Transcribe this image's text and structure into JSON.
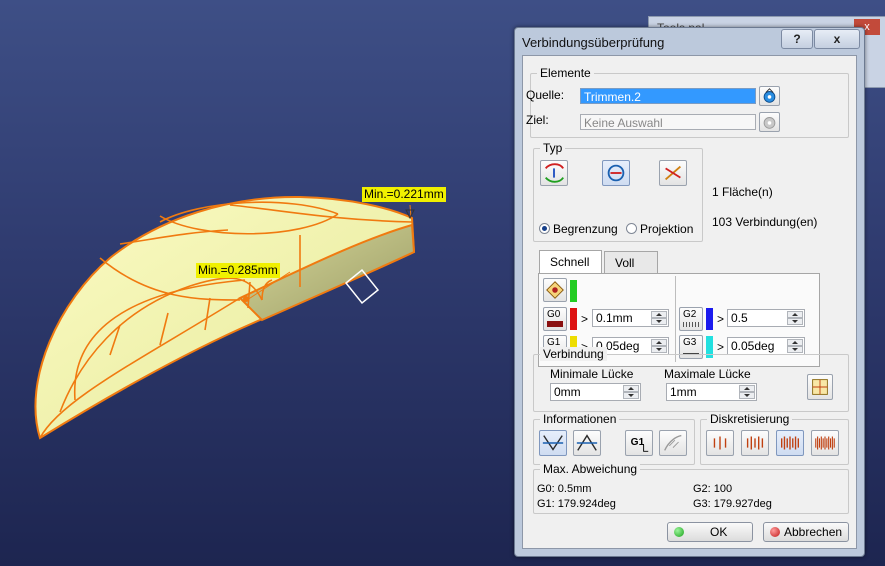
{
  "viewport": {
    "annotations": [
      {
        "text": "Min.=0.221mm"
      },
      {
        "text": "Min.=0.285mm"
      }
    ]
  },
  "background_window": {
    "title": "Tools pal...",
    "close_glyph": "x"
  },
  "dialog": {
    "title": "Verbindungsüberprüfung",
    "help_glyph": "?",
    "close_glyph": "x",
    "elemente": {
      "label": "Elemente",
      "quelle_label": "Quelle:",
      "quelle_value": "Trimmen.2",
      "ziel_label": "Ziel:",
      "ziel_placeholder": "Keine Auswahl"
    },
    "typ": {
      "label": "Typ",
      "radio_begrenzung": "Begrenzung",
      "radio_projektion": "Projektion",
      "selected": "Begrenzung",
      "info_faces": "1 Fläche(n)",
      "info_connections": "103 Verbindung(en)"
    },
    "tabs": {
      "schnell": "Schnell",
      "voll": "Voll",
      "active": "Schnell"
    },
    "thresholds": {
      "g0_label": "G0",
      "g1_label": "G1",
      "g2_label": "G2",
      "g3_label": "G3",
      "gt": ">",
      "g0_value": "0.1mm",
      "g1_value": "0.05deg",
      "g2_value": "0.5",
      "g3_value": "0.05deg",
      "colors": {
        "ok": "#22cc22",
        "g0": "#dd1111",
        "g1": "#eedd00",
        "g2": "#1a1aee",
        "g3": "#22e0e0"
      }
    },
    "verbindung": {
      "label": "Verbindung",
      "min_gap_label": "Minimale Lücke",
      "max_gap_label": "Maximale Lücke",
      "min_gap_value": "0mm",
      "max_gap_value": "1mm"
    },
    "informationen": {
      "label": "Informationen"
    },
    "diskretisierung": {
      "label": "Diskretisierung"
    },
    "max_abweichung": {
      "label": "Max. Abweichung",
      "g0": "G0: 0.5mm",
      "g1": "G1: 179.924deg",
      "g2": "G2: 100",
      "g3": "G3: 179.927deg"
    },
    "buttons": {
      "ok": "OK",
      "cancel": "Abbrechen"
    }
  }
}
